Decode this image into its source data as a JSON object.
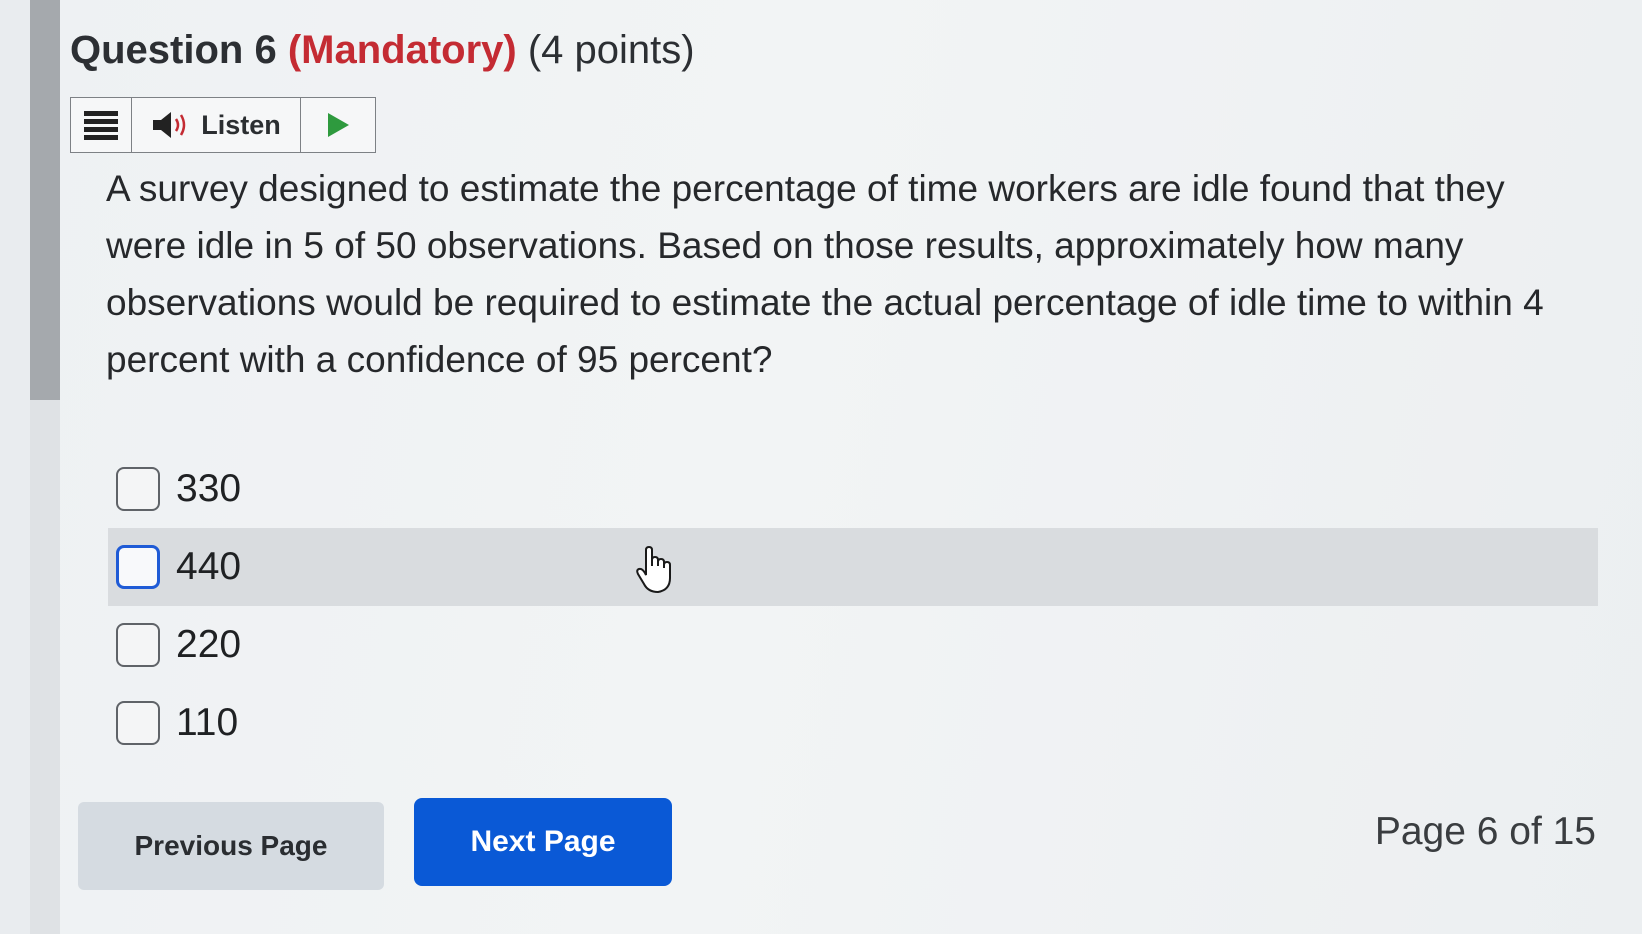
{
  "question": {
    "title": "Question 6",
    "mandatory": "(Mandatory)",
    "points": "(4 points)",
    "text": "A survey designed to estimate the percentage of time workers are idle found that they were idle in 5 of 50 observations. Based on those results, approximately how many observations would be required to estimate the actual percentage of idle time to within 4 percent with a confidence of 95 percent?"
  },
  "readspeaker": {
    "menu_icon": "hamburger-icon",
    "speaker_icon": "speaker-icon",
    "listen_label": "Listen",
    "play_icon": "play-icon"
  },
  "options": [
    {
      "label": "330",
      "checked": false
    },
    {
      "label": "440",
      "checked": false,
      "hovered": true
    },
    {
      "label": "220",
      "checked": false
    },
    {
      "label": "110",
      "checked": false
    }
  ],
  "navigation": {
    "previous_label": "Previous Page",
    "next_label": "Next Page",
    "page_indicator": "Page 6 of 15"
  },
  "colors": {
    "mandatory": "#c42b33",
    "primary_button": "#0a59d6",
    "hover_checkbox": "#1f5bd6",
    "play_green": "#2e9a3e"
  }
}
